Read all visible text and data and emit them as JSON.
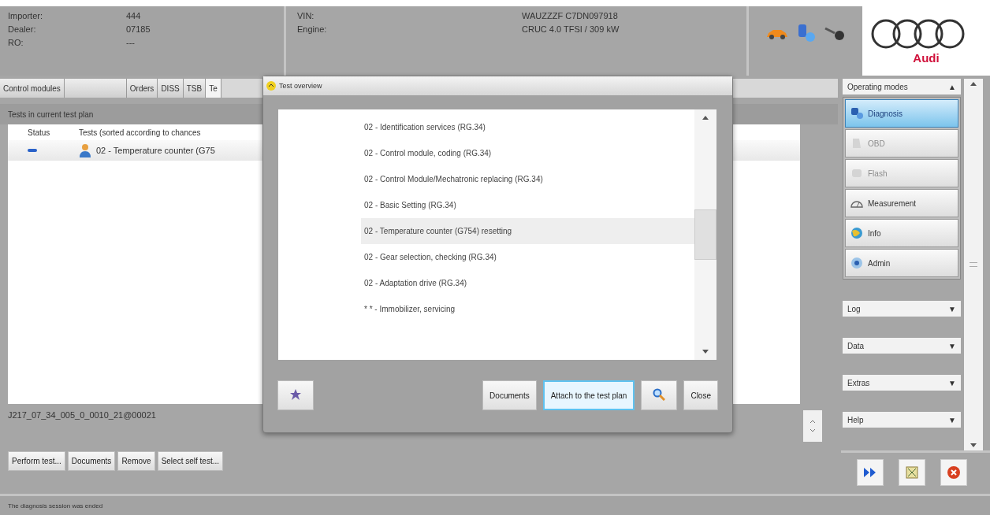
{
  "header": {
    "fields": [
      {
        "label": "Importer:",
        "value": "444"
      },
      {
        "label": "Dealer:",
        "value": "07185"
      },
      {
        "label": "RO:",
        "value": "---"
      }
    ],
    "vehicle": [
      {
        "label": "VIN:",
        "value": "WAUZZZF C7DN097918"
      },
      {
        "label": "Engine:",
        "value": "CRUC 4.0 TFSI / 309 kW"
      }
    ],
    "brand": "Audi"
  },
  "tabs": [
    {
      "label": "Control modules",
      "selected": false
    },
    {
      "kind": "blank",
      "selected": false
    },
    {
      "label": "Orders",
      "selected": false
    },
    {
      "label": "DISS",
      "selected": false
    },
    {
      "label": "TSB",
      "selected": false
    },
    {
      "label": "Te",
      "selected": true
    }
  ],
  "test_plan": {
    "title": "Tests in current test plan",
    "columns": [
      "Status",
      "Tests (sorted according to chances"
    ],
    "rows": [
      {
        "test": "02 - Temperature counter (G75"
      }
    ],
    "footer": "J217_07_34_005_0_0010_21@00021",
    "buttons": [
      "Perform test...",
      "Documents",
      "Remove",
      "Select self test..."
    ]
  },
  "dialog": {
    "title": "Test overview",
    "items": [
      {
        "label": "02 - Identification services (RG.34)",
        "selected": false
      },
      {
        "label": "02 - Control module, coding (RG.34)",
        "selected": false
      },
      {
        "label": "02 - Control Module/Mechatronic replacing (RG.34)",
        "selected": false
      },
      {
        "label": "02 - Basic Setting (RG.34)",
        "selected": false
      },
      {
        "label": "02 - Temperature counter (G754) resetting",
        "selected": true
      },
      {
        "label": "02 - Gear selection, checking (RG.34)",
        "selected": false
      },
      {
        "label": "02 - Adaptation drive (RG.34)",
        "selected": false
      },
      {
        "label": "* * - Immobilizer, servicing",
        "selected": false
      }
    ],
    "buttons": [
      {
        "kind": "star"
      },
      {
        "kind": "text",
        "label": "Documents",
        "selected": false
      },
      {
        "kind": "text",
        "label": "Attach to the test plan",
        "selected": true
      },
      {
        "kind": "search"
      },
      {
        "kind": "text",
        "label": "Close",
        "selected": false
      }
    ]
  },
  "sidebar": {
    "title": "Operating modes",
    "toggle": "▲",
    "modes": [
      {
        "label": "Diagnosis",
        "kind": "diagnosis",
        "selected": true,
        "disabled": false
      },
      {
        "label": "OBD",
        "kind": "obd",
        "selected": false,
        "disabled": true
      },
      {
        "label": "Flash",
        "kind": "flash",
        "selected": false,
        "disabled": true
      },
      {
        "label": "Measurement",
        "kind": "gauge",
        "selected": false,
        "disabled": false
      },
      {
        "label": "Info",
        "kind": "globe",
        "selected": false,
        "disabled": false
      },
      {
        "label": "Admin",
        "kind": "admin",
        "selected": false,
        "disabled": false
      }
    ],
    "panels": [
      {
        "label": "Log",
        "toggle": "▼"
      },
      {
        "label": "Data",
        "toggle": "▼"
      },
      {
        "label": "Extras",
        "toggle": "▼"
      },
      {
        "label": "Help",
        "toggle": "▼"
      }
    ]
  },
  "status_bar": "The diagnosis session was ended"
}
